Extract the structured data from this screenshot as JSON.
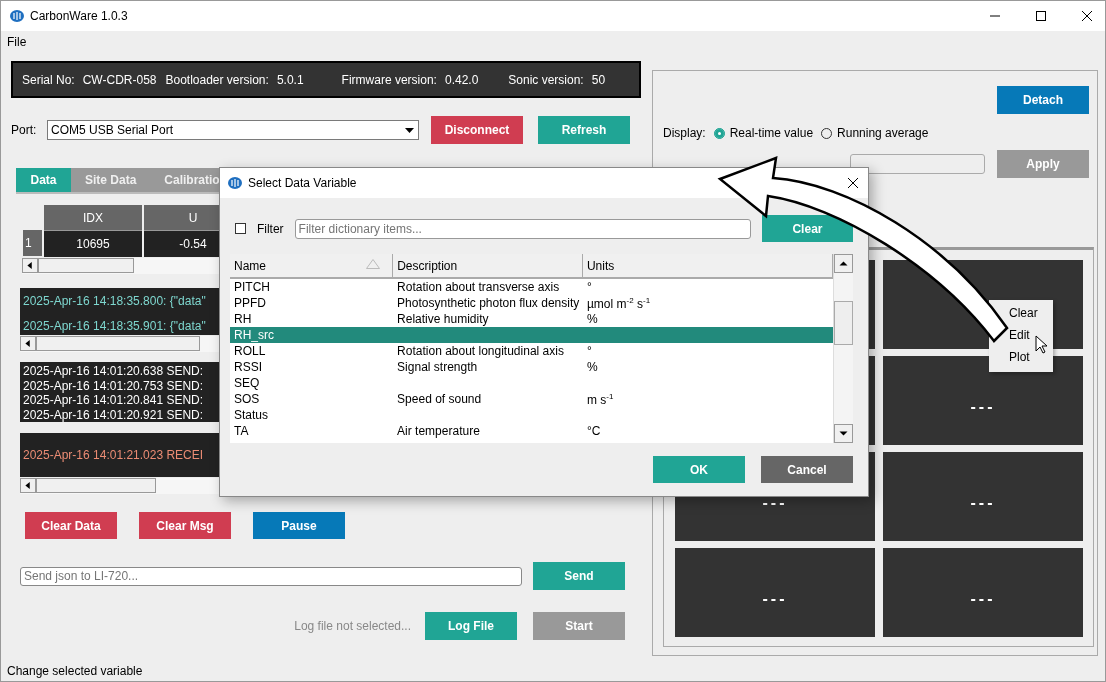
{
  "window": {
    "title": "CarbonWare 1.0.3"
  },
  "menu": [
    {
      "label": "File"
    }
  ],
  "device_info": [
    {
      "label": "Serial No:",
      "value": "CW-CDR-058"
    },
    {
      "label": "Bootloader version:",
      "value": "5.0.1"
    },
    {
      "label": "Firmware version:",
      "value": "0.42.0"
    },
    {
      "label": "Sonic version:",
      "value": "50"
    }
  ],
  "port": {
    "label": "Port:",
    "value": "COM5 USB Serial Port"
  },
  "connection_buttons": [
    {
      "label": "Disconnect",
      "kind": "danger"
    },
    {
      "label": "Refresh",
      "kind": "primary"
    }
  ],
  "tabs": [
    {
      "label": "Data",
      "selected": true
    },
    {
      "label": "Site Data",
      "selected": false
    },
    {
      "label": "Calibratio",
      "selected": false
    }
  ],
  "data_table": {
    "columns": [
      "IDX",
      "U"
    ],
    "rows": [
      {
        "header": "1",
        "cells": [
          "10695",
          "-0.54"
        ]
      }
    ]
  },
  "messages": [
    {
      "kind": "data",
      "lines": [
        "2025-Apr-16 14:18:35.800: {\"data\"",
        "2025-Apr-16 14:18:35.901: {\"data\""
      ]
    },
    {
      "kind": "send",
      "lines": [
        "2025-Apr-16 14:01:20.638 SEND:",
        "2025-Apr-16 14:01:20.753 SEND:",
        "2025-Apr-16 14:01:20.841 SEND:",
        "2025-Apr-16 14:01:20.921 SEND:"
      ]
    },
    {
      "kind": "receive",
      "lines": [
        "2025-Apr-16 14:01:21.023 RECEI"
      ]
    }
  ],
  "action_buttons": [
    {
      "label": "Clear Data",
      "kind": "danger"
    },
    {
      "label": "Clear Msg",
      "kind": "danger"
    },
    {
      "label": "Pause",
      "kind": "info"
    }
  ],
  "send": {
    "placeholder": "Send json to LI-720...",
    "button": "Send"
  },
  "logging": {
    "status": "Log file not selected...",
    "buttons": [
      {
        "label": "Log File",
        "kind": "primary"
      },
      {
        "label": "Start",
        "kind": "disabled"
      }
    ]
  },
  "status_bar": "Change selected variable",
  "display_panel": {
    "detach_button": "Detach",
    "display_label": "Display:",
    "options": [
      {
        "label": "Real-time value",
        "selected": true
      },
      {
        "label": "Running average",
        "selected": false
      }
    ],
    "apply_button": "Apply",
    "tiles": [
      {
        "value": "---"
      },
      {
        "value": "---"
      },
      {
        "value": "---"
      },
      {
        "value": "---"
      },
      {
        "value": "---"
      }
    ]
  },
  "context_menu": {
    "items": [
      "Clear",
      "Edit",
      "Plot"
    ]
  },
  "dialog": {
    "title": "Select Data Variable",
    "filter": {
      "label": "Filter",
      "checked": false,
      "placeholder": "Filter dictionary items..."
    },
    "clear_button": "Clear",
    "columns": [
      "Name",
      "Description",
      "Units"
    ],
    "rows": [
      {
        "name": "PITCH",
        "description": "Rotation about transverse axis",
        "units": "°",
        "selected": false
      },
      {
        "name": "PPFD",
        "description": "Photosynthetic photon flux density",
        "units": "µmol m$^{-2}$ s$^{-1}$",
        "selected": false
      },
      {
        "name": "RH",
        "description": "Relative humidity",
        "units": "%",
        "selected": false
      },
      {
        "name": "RH_src",
        "description": "",
        "units": "",
        "selected": true
      },
      {
        "name": "ROLL",
        "description": "Rotation about longitudinal axis",
        "units": "°",
        "selected": false
      },
      {
        "name": "RSSI",
        "description": "Signal strength",
        "units": "%",
        "selected": false
      },
      {
        "name": "SEQ",
        "description": "",
        "units": "",
        "selected": false
      },
      {
        "name": "SOS",
        "description": "Speed of sound",
        "units": "m s$^{-1}$",
        "selected": false
      },
      {
        "name": "Status",
        "description": "",
        "units": "",
        "selected": false
      },
      {
        "name": "TA",
        "description": "Air temperature",
        "units": "°C",
        "selected": false
      }
    ],
    "buttons": [
      {
        "label": "OK",
        "kind": "primary"
      },
      {
        "label": "Cancel",
        "kind": "secondary"
      }
    ]
  }
}
